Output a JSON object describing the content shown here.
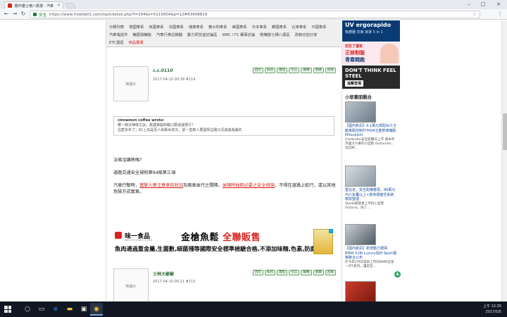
{
  "browser": {
    "tab_title": "動作靈士稽八悉選 - 汽車",
    "secure_label": "安全",
    "url": "https://www.mobile01.com/topicdetail.php?f=294&t=5115604&p=12#63949819"
  },
  "categories": {
    "row1": [
      "分類列表",
      "德國車系",
      "英國車系",
      "法國車系",
      "瑞典車系",
      "義大利車系",
      "美國車系",
      "日本車系",
      "韓國車系",
      "台灣車系",
      "中國車系"
    ],
    "row2": [
      "汽車電話件",
      "輪圈與輪胎",
      "汽車行車記錄器",
      "動力研究室討論區",
      "WRC / F1 賽事討論",
      "贈輔當七構八黑區",
      "改裝切割分享"
    ],
    "row3": [
      "ETC還逛",
      "商品實賣"
    ]
  },
  "post1": {
    "avatar_label": "無圖片",
    "author": "c.c.0110",
    "meta": "2017-04-10 00:18  #114",
    "actions": [
      "回文",
      "私訊",
      "連結",
      "引言",
      "編輯",
      "收藏",
      "回報"
    ]
  },
  "quote": {
    "head": "cinnamon coffee wrote:",
    "line1": "哪一條法律條文說，救護車開到路口要減速慢行？",
    "line2": "這麼多年了，81上氣是否人就擊出收文，卻一直救人要盡限這路口況減速為緩的"
  },
  "body": {
    "p1": "法條沒讀熟嗎？",
    "p2": "道路交通安全規則第94條第三項",
    "p3_a": "汽車行駛時，",
    "p3_red1": "駕駛人應注意車前狀況",
    "p3_b": "及兩車並行之間隔，",
    "p3_red2": "並隨時採取必要之安全措施",
    "p3_c": "，不得在道路上蛇行，或以其他危險方式駕車。"
  },
  "ad": {
    "brand": "味一食品",
    "brand_sub": "WEI YI FOODS CO.,LTD",
    "product": "金槍魚鬆",
    "product_hl": "全聯販售",
    "desc": "魚肉通過重金屬,生菌數,細菌殘等國際安全標準檢驗合格,不添加味精,色素,防腐劑."
  },
  "post2": {
    "avatar_label": "無圖片",
    "author": "士林大爺爺",
    "meta": "2017-04-10 00:21  #115",
    "actions": [
      "回文",
      "私訊",
      "連結",
      "引言",
      "編輯",
      "收藏",
      "回報"
    ]
  },
  "sidebar": {
    "ad_uv_title": "UV ergorapido",
    "ad_uv_sub": "吸塵器 完美 家家 5 in 1",
    "ad_news_a": "別忘了還有",
    "ad_news_b": "正妹制服",
    "ad_news_c": "青春開跑",
    "ad_steel_title": "DON'T THINK FEEL STEEL",
    "ad_steel_cta": "進擊登場",
    "section_title": "小眾賽朋觀合",
    "items": [
      {
        "headline": "【國內新訊】9.1萬元標配ACC主動車距控制升平KM主動煞車輔助 Mitsubishi",
        "text": "Outlander安全配備日上市 微本年市國大汽車的小型歐 Outlander，為這終..."
      },
      {
        "headline": "蓋在走，安全配備豐再，88萬元內六氣囊以上+車身穩健性系統車款整理",
        "text": "Skoda開發者上市的小型客 Octavia，除了..."
      },
      {
        "headline": "【國內新訊】新增動力選擇 BMW 528i Luxury與M Sport價格聯合公布",
        "text": "於今年2月日發表上市的BMW全新一代5系列，還是在..."
      },
      {
        "headline": "",
        "text": ""
      }
    ]
  },
  "taskbar": {
    "time": "上午 12:35",
    "date": "2017/5/5"
  }
}
